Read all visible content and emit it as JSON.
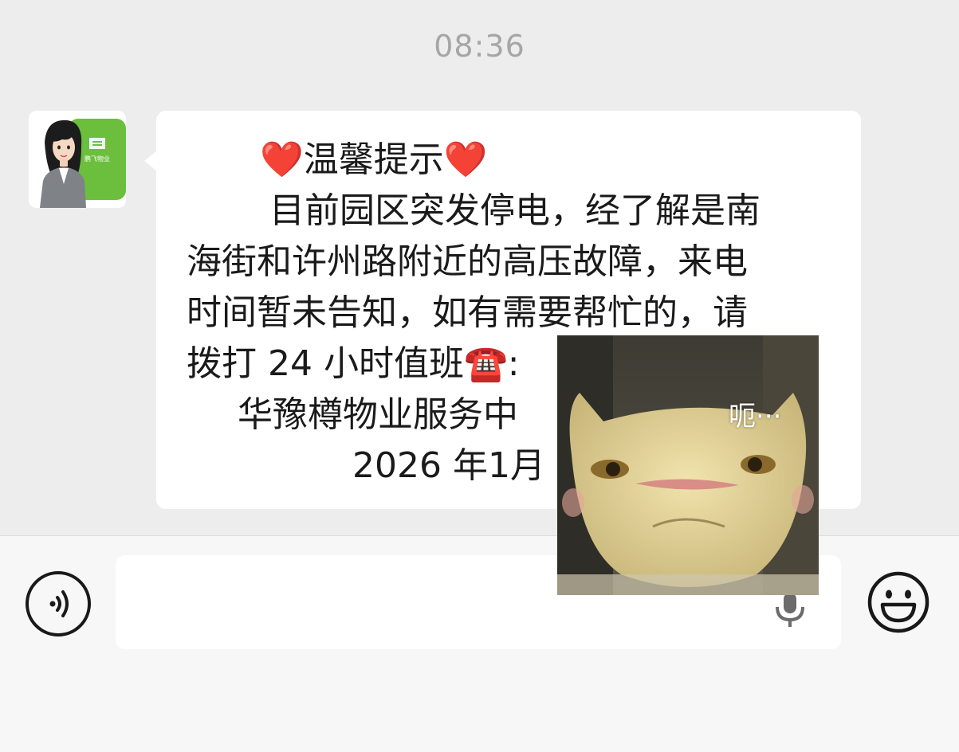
{
  "chat": {
    "timestamp": "08:36",
    "message": {
      "title_heart_left": "❤️",
      "title": "温馨提示",
      "title_heart_right": "❤️",
      "lines": [
        "目前园区突发停电，经了解是南",
        "海街和许州路附近的高压故障，来电",
        "时间暂未告知，如有需要帮忙的，请",
        "拨打 24 小时值班",
        "华豫樽物业服务中",
        "2026 年1月"
      ],
      "phone_icon": "☎️",
      "after_phone": ":"
    },
    "sender_avatar": {
      "icon": "avatar-icon",
      "logo_text": "鹏飞物业"
    }
  },
  "sticker": {
    "icon": "cat-sticker-icon",
    "caption": "呃···"
  },
  "input_bar": {
    "voice_icon": "voice-icon",
    "input_value": "",
    "mic_icon": "microphone-icon",
    "emoji_icon": "emoji-icon"
  },
  "colors": {
    "chat_background": "#ededed",
    "bubble": "#ffffff",
    "input_bar": "#f7f7f7",
    "avatar_green": "#6cbf3c"
  }
}
